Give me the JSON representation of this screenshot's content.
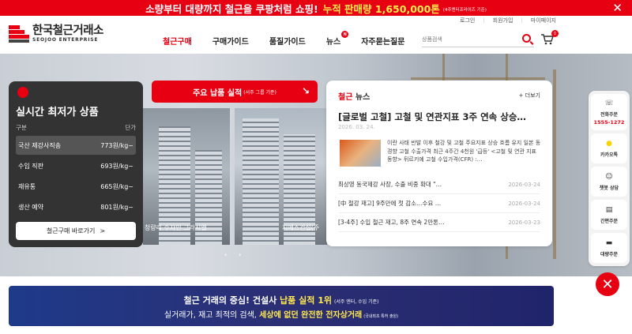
{
  "promo": {
    "text": "소량부터 대량까지 철근을 쿠팡처럼 쇼핑!",
    "highlight": "누적 판매량 1,650,000톤",
    "note": "(4주엔터프라이즈 기준)"
  },
  "util_links": [
    "로그인",
    "회원가입",
    "마이페이지"
  ],
  "logo": {
    "kr": "한국철근거래소",
    "en": "SEOJOO ENTERPRISE"
  },
  "nav": [
    {
      "label": "철근구매",
      "active": true
    },
    {
      "label": "구매가이드"
    },
    {
      "label": "품질가이드"
    },
    {
      "label": "뉴스",
      "badge": "N"
    },
    {
      "label": "자주묻는질문"
    }
  ],
  "search": {
    "placeholder": "상품검색"
  },
  "cart": {
    "badge": "0"
  },
  "realtime": {
    "title": "실시간 최저가 상품",
    "col_type": "구분",
    "col_price": "단가",
    "rows": [
      {
        "type": "국산 제강사직송",
        "price": "773원/kg~"
      },
      {
        "type": "수입 직판",
        "price": "693원/kg~"
      },
      {
        "type": "재유통",
        "price": "665원/kg~"
      },
      {
        "type": "생산 예약",
        "price": "801원/kg~"
      }
    ],
    "button": "철근구매 바로가기",
    "button_arrow": ">"
  },
  "delivery": {
    "title": "주요 납품 실적",
    "title_note": "(서주 그룹 기준)",
    "arrow": "↘",
    "caption_a": "랑 청량리 수자인 그라시엘",
    "caption_b": "지에스건설(주",
    "pager": "‹ ›"
  },
  "news": {
    "title_red": "철근",
    "title": "뉴스",
    "more": "+ 더보기",
    "headline": "[글로벌 고철] 고철 및 연관지표 3주 연속 상승…",
    "date": "2026. 03. 24.",
    "summary": "이란 사태 반발 이후 철강 및 고철 주요지표 상승 흐름 유지 일본 동경향 고철 수출가격 최근 4주간 4천원 '급등' <고철 및 연관 지표 동향> 뒤르키예 고철 수입가격(CFR) :…",
    "items": [
      {
        "title": "최상영 동국제강 사장, 수출 비중 확대 \"…",
        "date": "2026-03-24"
      },
      {
        "title": "[中 철강 재고] 9주만에 첫 감소…수요 …",
        "date": "2026-03-24"
      },
      {
        "title": "[3-4주] 수입 철근 재고, 8주 연속 2만톤…",
        "date": "2026-03-23"
      }
    ]
  },
  "side_menu": [
    {
      "label": "전화주문",
      "sub": "1555-1272",
      "icon": "phone-icon",
      "glyph": "☏"
    },
    {
      "label": "카카오톡",
      "icon": "kakao-icon",
      "glyph": "●"
    },
    {
      "label": "챗봇 상담",
      "icon": "chatbot-icon",
      "glyph": "☺"
    },
    {
      "label": "간편주문",
      "icon": "order-icon",
      "glyph": "▤"
    },
    {
      "label": "대량주문",
      "icon": "truck-icon",
      "glyph": "▬"
    }
  ],
  "close_label": "✕",
  "banner": {
    "l1a": "철근 거래의 중심!  건설사 ",
    "l1b": "납품 실적 1위",
    "l1note": "(서주 엔터, 수입 기준)",
    "l2a": "실거래가, 재고 최적의 검색, ",
    "l2b": "세상에 없던 완전한 전자상거래",
    "l2note": "(국내최초 특허 출원)"
  },
  "colors": {
    "brand": "#e60012",
    "banner": "#2c2f74",
    "highlight": "#ffe94d"
  }
}
